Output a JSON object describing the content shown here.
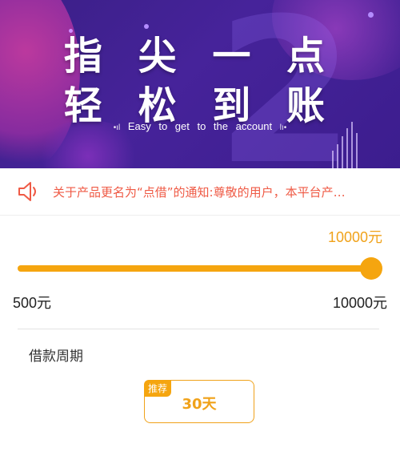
{
  "banner": {
    "headline_line1": "指 尖 一 点",
    "headline_line2": "轻 松 到 账",
    "tagline": "Easy to get to the account",
    "tag_mark_left": "•ıl",
    "tag_mark_right": "lı•"
  },
  "notice": {
    "icon": "speaker-icon",
    "text": "关于产品更名为“点借”的通知:尊敬的用户，本平台产…",
    "color": "#ef5a45"
  },
  "loan_amount": {
    "selected_label": "10000元",
    "min_label": "500元",
    "max_label": "10000元",
    "min": 500,
    "max": 10000,
    "value": 10000,
    "accent_color": "#f5a50f"
  },
  "loan_period": {
    "title": "借款周期",
    "options": [
      {
        "badge": "推荐",
        "label": "30天",
        "selected": true
      }
    ]
  }
}
